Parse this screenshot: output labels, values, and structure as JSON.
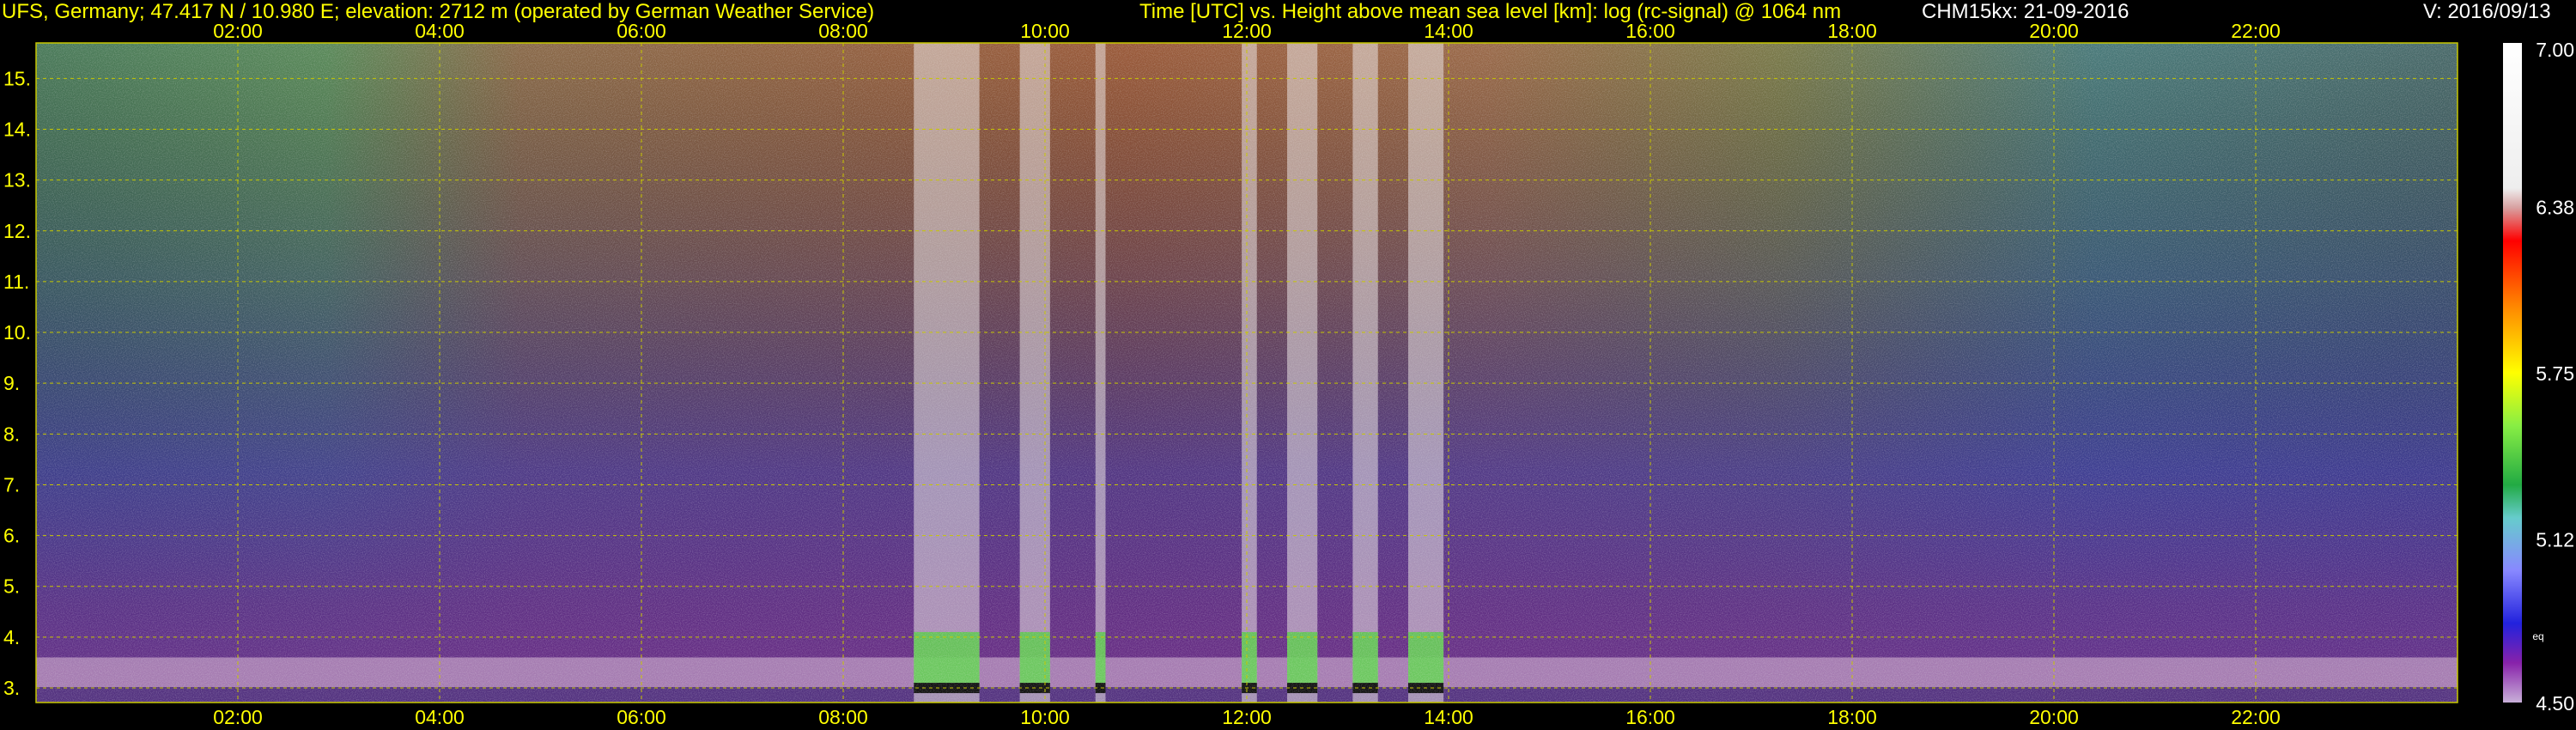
{
  "header": {
    "station": "UFS, Germany; 47.417 N / 10.980 E; elevation: 2712 m  (operated by German Weather Service)",
    "description": "Time [UTC] vs. Height above mean sea level [km]: log (rc-signal) @ 1064 nm",
    "instrument_date": "CHM15kx: 21-09-2016",
    "version": "V: 2016/09/13"
  },
  "colors": {
    "header_text": "#ffff00",
    "tick_text": "#ffff00",
    "grid": "#c8c800",
    "background": "#000000"
  },
  "chart_data": {
    "type": "heatmap",
    "xlabel": "Time [UTC]",
    "ylabel": "Height above mean sea level [km]",
    "x_ticks": [
      "02:00",
      "04:00",
      "06:00",
      "08:00",
      "10:00",
      "12:00",
      "14:00",
      "16:00",
      "18:00",
      "20:00",
      "22:00"
    ],
    "x_tick_hours": [
      2,
      4,
      6,
      8,
      10,
      12,
      14,
      16,
      18,
      20,
      22
    ],
    "x_range_hours": [
      0,
      24
    ],
    "y_ticks": [
      "3.",
      "4.",
      "5.",
      "6.",
      "7.",
      "8.",
      "9.",
      "10.",
      "11.",
      "12.",
      "13.",
      "14.",
      "15."
    ],
    "y_tick_values": [
      3,
      4,
      5,
      6,
      7,
      8,
      9,
      10,
      11,
      12,
      13,
      14,
      15
    ],
    "y_range_km": [
      2.712,
      15.7
    ],
    "grid": true,
    "colorbar": {
      "labels": [
        "7.00",
        "6.38",
        "5.75",
        "5.12",
        "4.50"
      ],
      "values": [
        7.0,
        6.38,
        5.75,
        5.12,
        4.5
      ],
      "range": [
        4.5,
        7.0
      ],
      "small_label": "eq"
    },
    "boundary_layer_top_km": 3.6,
    "precipitation_columns_hours": [
      [
        8.7,
        9.35
      ],
      [
        9.75,
        10.05
      ],
      [
        10.5,
        10.6
      ],
      [
        11.95,
        12.1
      ],
      [
        12.4,
        12.7
      ],
      [
        13.05,
        13.3
      ],
      [
        13.6,
        13.95
      ]
    ]
  }
}
